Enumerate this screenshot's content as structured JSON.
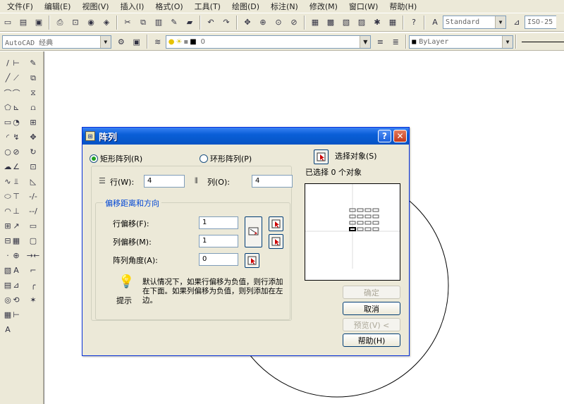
{
  "menubar": {
    "items": [
      "文件(F)",
      "编辑(E)",
      "视图(V)",
      "插入(I)",
      "格式(O)",
      "工具(T)",
      "绘图(D)",
      "标注(N)",
      "修改(M)",
      "窗口(W)",
      "帮助(H)"
    ]
  },
  "toolbar": {
    "text_style": "Standard",
    "dim_style": "ISO-25",
    "workspace": "AutoCAD 经典",
    "layer": "0",
    "color": "ByLayer"
  },
  "dialog": {
    "title": "阵列",
    "radio_rect": "矩形阵列(R)",
    "radio_polar": "环形阵列(P)",
    "select_objects_label": "选择对象(S)",
    "selected_count_text": "已选择 0 个对象",
    "rows_label": "行(W):",
    "rows_value": "4",
    "cols_label": "列(O):",
    "cols_value": "4",
    "offset_group_title": "偏移距离和方向",
    "row_offset_label": "行偏移(F):",
    "row_offset_value": "1",
    "col_offset_label": "列偏移(M):",
    "col_offset_value": "1",
    "angle_label": "阵列角度(A):",
    "angle_value": "0",
    "tip_text": "默认情况下，如果行偏移为负值，则行添加在下面。如果列偏移为负值，则列添加在左边。",
    "tip_label": "提示",
    "ok_button": "确定",
    "cancel_button": "取消",
    "preview_button": "预览(V) <",
    "help_button": "帮助(H)"
  },
  "colors": {
    "title_bar": "#0a5fd8",
    "dialog_bg": "#ece9d8",
    "group_title": "#0046d5"
  },
  "icons": {
    "help": "help-icon",
    "close": "close-icon",
    "pick": "pick-point-icon",
    "tip": "lightbulb-icon"
  }
}
